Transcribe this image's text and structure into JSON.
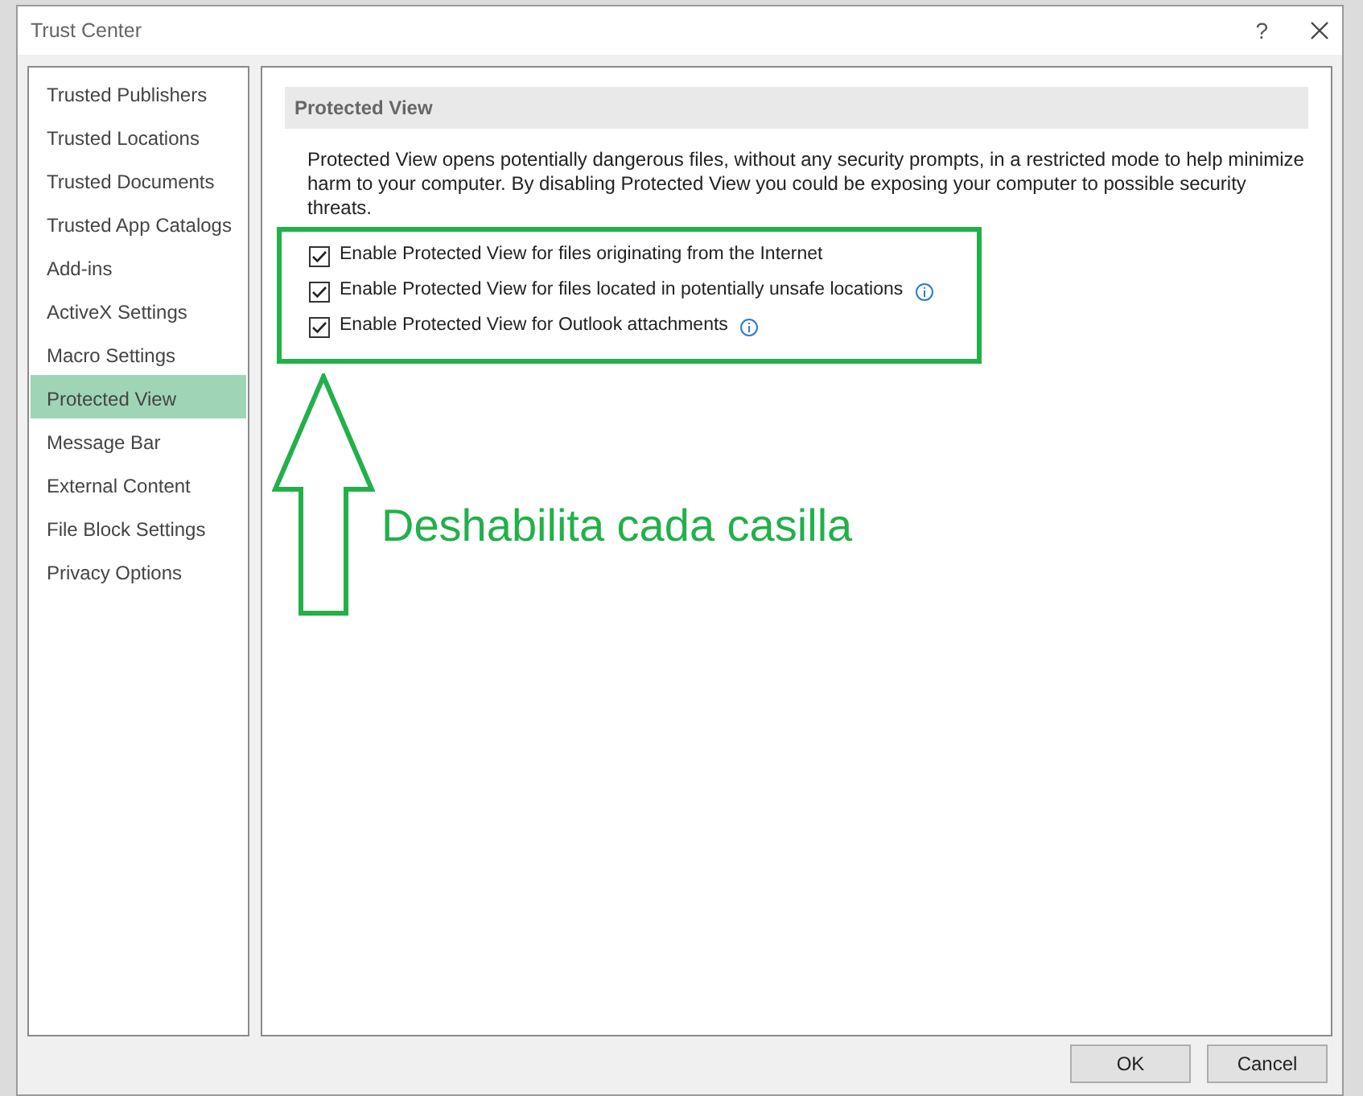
{
  "window": {
    "title": "Trust Center",
    "help": "?"
  },
  "sidebar": {
    "items": [
      {
        "label": "Trusted Publishers",
        "selected": false
      },
      {
        "label": "Trusted Locations",
        "selected": false
      },
      {
        "label": "Trusted Documents",
        "selected": false
      },
      {
        "label": "Trusted App Catalogs",
        "selected": false
      },
      {
        "label": "Add-ins",
        "selected": false
      },
      {
        "label": "ActiveX Settings",
        "selected": false
      },
      {
        "label": "Macro Settings",
        "selected": false
      },
      {
        "label": "Protected View",
        "selected": true
      },
      {
        "label": "Message Bar",
        "selected": false
      },
      {
        "label": "External Content",
        "selected": false
      },
      {
        "label": "File Block Settings",
        "selected": false
      },
      {
        "label": "Privacy Options",
        "selected": false
      }
    ]
  },
  "section": {
    "title": "Protected View",
    "description": "Protected View opens potentially dangerous files, without any security prompts, in a restricted mode to help minimize harm to your computer. By disabling Protected View you could be exposing your computer to possible security threats.",
    "options": [
      {
        "label": "Enable Protected View for files originating from the Internet",
        "checked": true,
        "info": false
      },
      {
        "label": "Enable Protected View for files located in potentially unsafe locations",
        "checked": true,
        "info": true
      },
      {
        "label": "Enable Protected View for Outlook attachments",
        "checked": true,
        "info": true
      }
    ]
  },
  "annotation": {
    "text": "Deshabilita cada casilla"
  },
  "buttons": [
    "OK",
    "Cancel"
  ]
}
